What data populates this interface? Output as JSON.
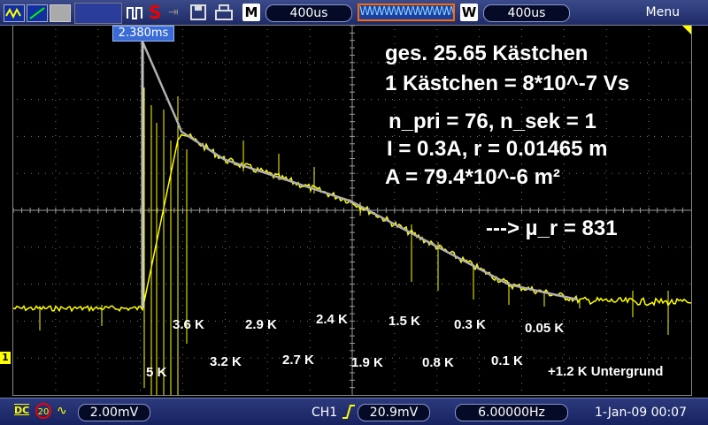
{
  "toolbar": {
    "run_icon": "wave-run-icon",
    "stop_icon": "stop-s-icon",
    "save_icons": [
      "usb-icon",
      "save-icon",
      "print-icon"
    ],
    "m_label": "M",
    "m_value": "400us",
    "wave_label": "WWWWWWWWWW",
    "w_label": "W",
    "w_value": "400us",
    "menu": "Menu"
  },
  "cursor_readout": "2.380ms",
  "channel_marker": "1",
  "annotations": {
    "line1": "ges. 25.65 Kästchen",
    "line2": "1 Kästchen = 8*10^-7 Vs",
    "line3": "n_pri = 76, n_sek = 1",
    "line4": "I = 0.3A, r = 0.01465 m",
    "line5": "A = 79.4*10^-6 m²",
    "result": "---> µ_r = 831"
  },
  "labels_upper": [
    "3.6 K",
    "2.9 K",
    "2.4 K",
    "1.5 K",
    "0.3 K",
    "0.05 K"
  ],
  "labels_lower": [
    "5 K",
    "3.2 K",
    "2.7 K",
    "1.9 K",
    "0.8 K",
    "0.1 K",
    "+1.2 K Untergrund"
  ],
  "status": {
    "coupling": "DC",
    "bw": "20",
    "ch_scale": "2.00mV",
    "trigger_ch": "CH1",
    "trigger_level": "20.9mV",
    "frequency": "6.00000Hz",
    "datetime": "1-Jan-09 00:07"
  },
  "colors": {
    "trace": "#ffff00",
    "fit": "#b0b0b0",
    "topbar": "#1d2a66",
    "accent": "#ff6a00"
  }
}
